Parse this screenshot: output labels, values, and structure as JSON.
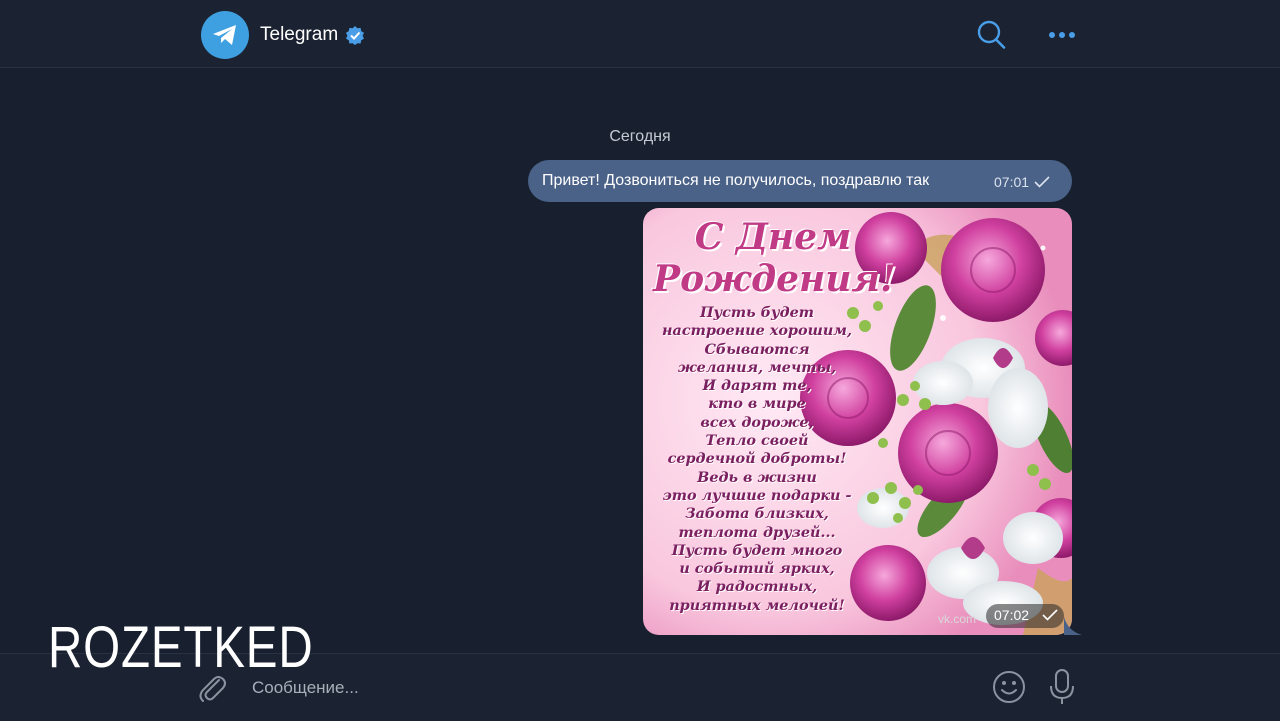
{
  "header": {
    "title": "Telegram",
    "verified": true,
    "avatar_icon": "telegram-paper-plane-icon",
    "search_icon": "search-icon",
    "more_icon": "more-dots-icon",
    "accent_color": "#3ea0e0"
  },
  "chat": {
    "date_divider": "Сегодня",
    "messages": [
      {
        "type": "text",
        "text": "Привет! Дозвониться не получилось, поздравлю так",
        "time": "07:01",
        "status_icon": "check-icon",
        "bubble_color": "#4a6188"
      },
      {
        "type": "image",
        "time": "07:02",
        "status_icon": "check-icon",
        "image": {
          "heading_lines": [
            "С Днем",
            "Рождения!"
          ],
          "poem_lines": [
            "Пусть будет",
            "настроение хорошим,",
            "Сбываются",
            "желания, мечты,",
            "И дарят те,",
            "кто в мире",
            "всех дороже,",
            "Тепло своей",
            "сердечной доброты!",
            "Ведь в жизни",
            "это лучшие подарки -",
            "Забота близких,",
            "теплота друзей...",
            "Пусть будет много",
            "и событий ярких,",
            "И радостных,",
            "приятных мелочей!"
          ],
          "watermark": "vk.com"
        }
      }
    ]
  },
  "composer": {
    "placeholder": "Сообщение...",
    "attach_icon": "paperclip-icon",
    "emoji_icon": "emoji-icon",
    "mic_icon": "microphone-icon"
  },
  "overlay": {
    "logo_text": "ROZETKED"
  }
}
